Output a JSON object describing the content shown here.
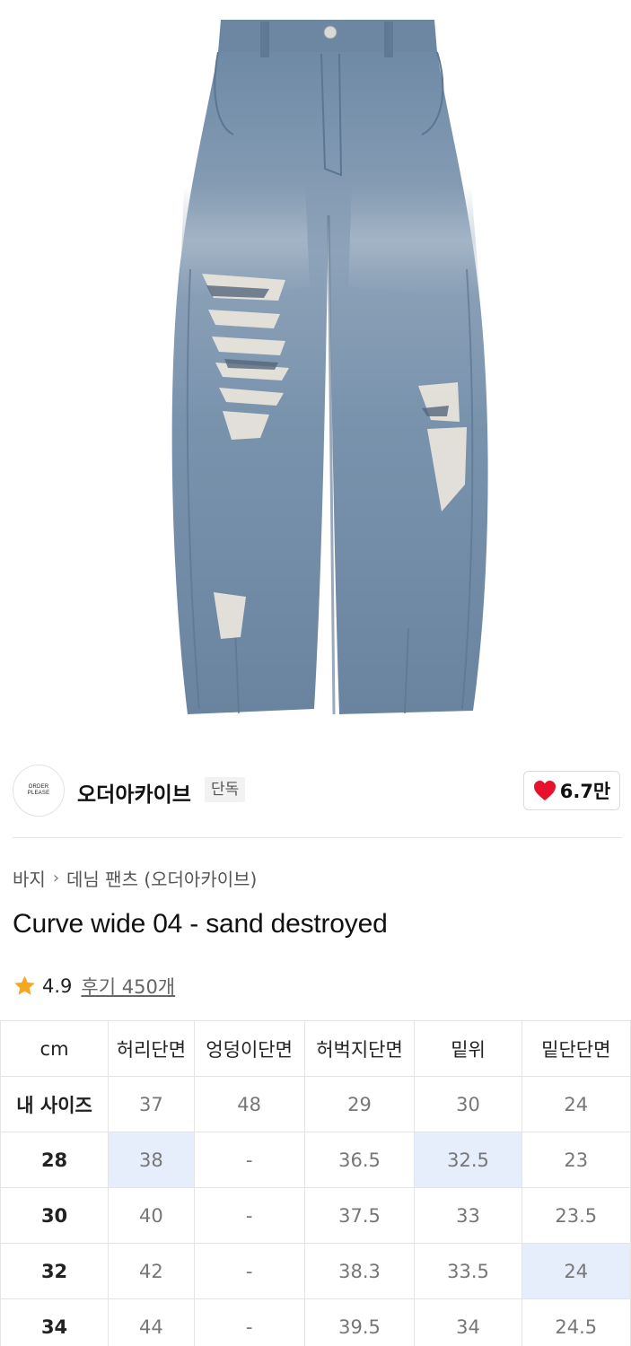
{
  "brand": {
    "logo_line1": "ORDER",
    "logo_line2": "PLEASE",
    "name": "오더아카이브",
    "badge": "단독",
    "like_count": "6.7만",
    "like_color": "#e8112d"
  },
  "breadcrumb": {
    "category": "바지",
    "separator": "›",
    "subcategory": "데님 팬츠 (오더아카이브)"
  },
  "product": {
    "title": "Curve wide 04 - sand destroyed",
    "rating": "4.9",
    "review_link": "후기 450개",
    "star_color": "#f5a623"
  },
  "size_table": {
    "headers": [
      "cm",
      "허리단면",
      "엉덩이단면",
      "허벅지단면",
      "밑위",
      "밑단단면"
    ],
    "rows": [
      {
        "label": "내 사이즈",
        "values": [
          "37",
          "48",
          "29",
          "30",
          "24"
        ]
      },
      {
        "label": "28",
        "values": [
          "38",
          "-",
          "36.5",
          "32.5",
          "23"
        ]
      },
      {
        "label": "30",
        "values": [
          "40",
          "-",
          "37.5",
          "33",
          "23.5"
        ]
      },
      {
        "label": "32",
        "values": [
          "42",
          "-",
          "38.3",
          "33.5",
          "24"
        ]
      },
      {
        "label": "34",
        "values": [
          "44",
          "-",
          "39.5",
          "34",
          "24.5"
        ]
      }
    ],
    "highlight_color": "#e6edfb"
  }
}
